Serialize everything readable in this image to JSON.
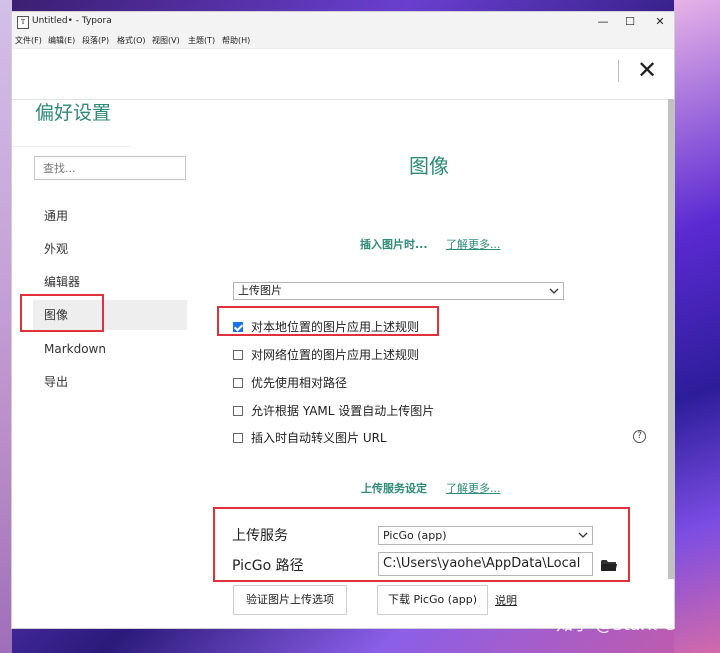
{
  "window": {
    "title": "Untitled• - Typora",
    "app_icon": "T",
    "minimize": "—",
    "maximize": "☐",
    "close": "✕"
  },
  "menu": [
    "文件(F)",
    "编辑(E)",
    "段落(P)",
    "格式(O)",
    "视图(V)",
    "主题(T)",
    "帮助(H)"
  ],
  "header": {
    "close_glyph": "✕"
  },
  "preferences": {
    "title": "偏好设置",
    "search_placeholder": "查找...",
    "nav": [
      "通用",
      "外观",
      "编辑器",
      "图像",
      "Markdown",
      "导出"
    ],
    "active_nav": "图像"
  },
  "image_section": {
    "title": "图像",
    "insert_label": "插入图片时...",
    "learn_more": "了解更多...",
    "insert_action": "上传图片",
    "options": [
      {
        "label": "对本地位置的图片应用上述规则",
        "checked": true
      },
      {
        "label": "对网络位置的图片应用上述规则",
        "checked": false
      },
      {
        "label": "优先使用相对路径",
        "checked": false
      },
      {
        "label": "允许根据 YAML 设置自动上传图片",
        "checked": false
      },
      {
        "label": "插入时自动转义图片 URL",
        "checked": false
      }
    ],
    "help_glyph": "?"
  },
  "upload_section": {
    "title": "上传服务设定",
    "learn_more": "了解更多...",
    "service_label": "上传服务",
    "service_value": "PicGo (app)",
    "path_label": "PicGo 路径",
    "path_value": "C:\\Users\\yaohe\\AppData\\Local",
    "verify_button": "验证图片上传选项",
    "download_button": "下载 PicGo (app)",
    "explain_link": "说明"
  },
  "watermark": "知乎 @Stark-C",
  "colors": {
    "accent": "#2e8b7a",
    "highlight": "#e0303a",
    "checkbox": "#1a73e8"
  }
}
